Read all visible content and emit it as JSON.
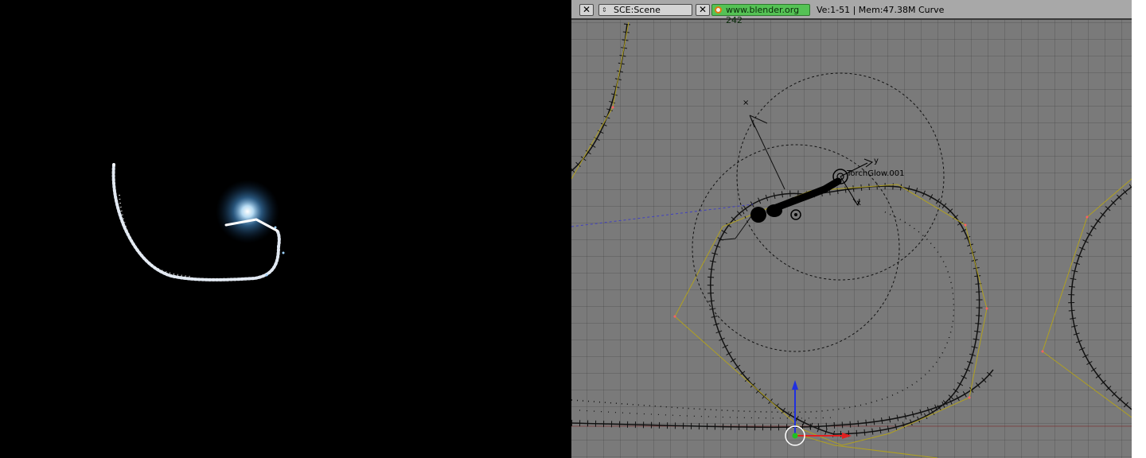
{
  "header": {
    "close_icon": "x-icon",
    "scene": "SCE:Scene",
    "website": "www.blender.org 242",
    "stats": "Ve:1-51 | Mem:47.38M Curve"
  },
  "viewport": {
    "object_label": "TorchGlow.001",
    "axis_label": "y",
    "axis_label_x": "x"
  },
  "colors": {
    "render_bg": "#000000",
    "viewport_bg": "#7a7a7a",
    "header_bg": "#a8a8a8",
    "link_button": "#55c255",
    "curve_yellow": "#b0a020",
    "manipulator_z": "#2030e0",
    "manipulator_x": "#e02020",
    "manipulator_y": "#20c020",
    "glow": "#8fd0ff"
  }
}
